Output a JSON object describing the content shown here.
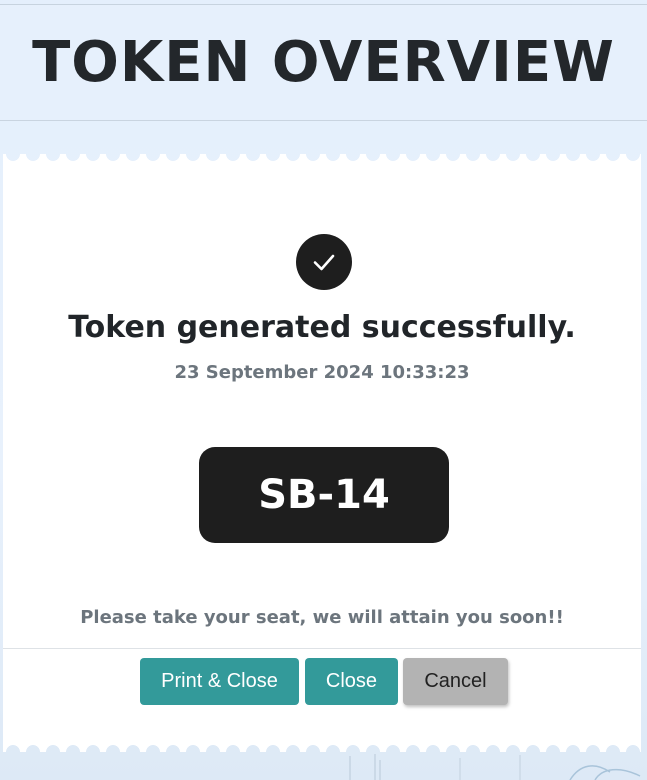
{
  "header": {
    "title": "TOKEN OVERVIEW"
  },
  "ticket": {
    "icon": "check-circle-icon",
    "title": "Token generated successfully.",
    "timestamp": "23 September 2024 10:33:23",
    "token_number": "SB-14",
    "message": "Please take your seat, we will attain you soon!!"
  },
  "actions": {
    "print_close_label": "Print & Close",
    "close_label": "Close",
    "cancel_label": "Cancel"
  },
  "colors": {
    "accent": "#339a9a",
    "dark": "#1e1e1e",
    "muted_text": "#6c757d",
    "cancel_bg": "#b3b3b3",
    "page_bg": "#e6f0fc"
  }
}
